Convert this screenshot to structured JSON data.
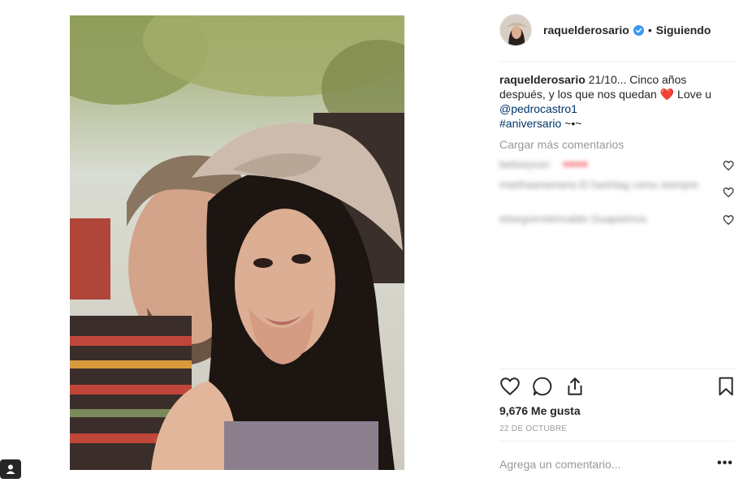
{
  "post": {
    "username": "raquelderosario",
    "follow_status": "Siguiendo",
    "separator": "•",
    "caption": {
      "username": "raquelderosario",
      "text_1": " 21/10... Cinco años después, y los que nos quedan ",
      "heart": "❤️",
      "text_2": " Love u ",
      "mention": "@pedrocastro1",
      "hashtag": "#aniversario",
      "tail": " ~•~"
    },
    "load_more": "Cargar más comentarios",
    "comments": [
      {
        "text": "betiseyvon",
        "extra": "♥♥♥♥"
      },
      {
        "text": "marthaanamaria El hashtag como siempre",
        "extra": ""
      },
      {
        "text": "elisegoinsleinvaldo Guapisimos",
        "extra": ""
      }
    ],
    "likes": "9,676 Me gusta",
    "date": "22 DE OCTUBRE",
    "comment_placeholder": "Agrega un comentario...",
    "more_label": "•••"
  },
  "icons": {
    "like": "heart-icon",
    "comment": "comment-icon",
    "share": "share-icon",
    "save": "bookmark-icon",
    "verified": "verified-badge-icon",
    "user_tag": "user-tag-icon"
  },
  "colors": {
    "text": "#262626",
    "muted": "#999999",
    "link": "#003569",
    "verified": "#3897f0",
    "heart": "#ed4956"
  }
}
